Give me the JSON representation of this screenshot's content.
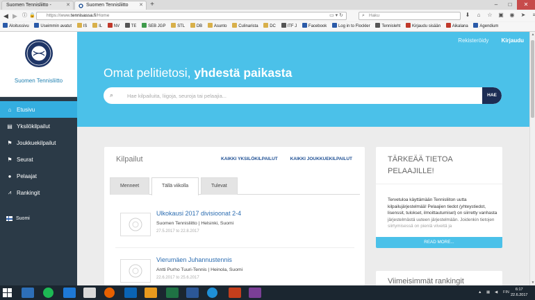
{
  "browser": {
    "tabs": [
      {
        "label": "Suomen Tennisliitto -",
        "active": false
      },
      {
        "label": "Suomen Tennisliitto",
        "active": true
      }
    ],
    "url_prefix": "https://www.",
    "url_domain": "tennisassa.fi",
    "url_path": "/Home",
    "search_placeholder": "Haku",
    "bookmarks": [
      "Aloitussivu",
      "Useimmin avatut",
      "IS",
      "IL",
      "NV",
      "TE",
      "SEB JGP",
      "STL",
      "DB",
      "Asunto",
      "Culinarista",
      "DC",
      "ITF J",
      "Facebook",
      "Log in to Flockler",
      "Tennisleht",
      "Kirjaudu sisään",
      "Aikalana",
      "Agendium"
    ]
  },
  "sidebar": {
    "brand_name": "Suomen Tennisliitto",
    "items": [
      {
        "label": "Etusivu",
        "icon": "home-icon",
        "active": true
      },
      {
        "label": "Yksilökilpailut",
        "icon": "id-card-icon",
        "active": false
      },
      {
        "label": "Joukkuekilpailut",
        "icon": "flag-icon",
        "active": false
      },
      {
        "label": "Seurat",
        "icon": "flag-icon",
        "active": false
      },
      {
        "label": "Pelaajat",
        "icon": "user-icon",
        "active": false
      },
      {
        "label": "Rankingit",
        "icon": "chart-icon",
        "active": false
      }
    ],
    "language": "Suomi"
  },
  "header": {
    "register": "Rekisteröidy",
    "login": "Kirjaudu",
    "title_light": "Omat pelitietosi, ",
    "title_bold": "yhdestä paikasta",
    "search_placeholder": "Hae kilpailuita, liigoja, seuroja tai pelaajia...",
    "search_button": "HAE"
  },
  "competitions": {
    "title": "Kilpailut",
    "link_individual": "KAIKKI YKSILÖKILPAILUT",
    "link_team": "KAIKKI JOUKKUEKILPAILUT",
    "tabs": [
      {
        "label": "Menneet",
        "active": false
      },
      {
        "label": "Tällä viikolla",
        "active": true
      },
      {
        "label": "Tulevat",
        "active": false
      }
    ],
    "items": [
      {
        "name": "Ulkokausi 2017 divisioonat 2-4",
        "organizer": "Suomen Tennisliitto | Helsinki, Suomi",
        "dates": "27.5.2017 to 22.8.2017"
      },
      {
        "name": "Vierumäen Juhannustennis",
        "organizer": "Antti Purho Tuuri-Tennis | Heinola, Suomi",
        "dates": "22.6.2017 to 25.6.2017"
      }
    ]
  },
  "info": {
    "title": "TÄRKEÄÄ TIETOA PELAAJILLE!",
    "body": "Tervetuloa käyttämään Tennisliiton uutta kilpailujärjestelmää! Pelaajien tiedot (yhteystiedot, lisenssit, tulokset, ilmoittautumiset) on siirretty vanhasta järjestelmästä uuteen järjestelmään. Joidenkin tietojen siirtymisessä on pieniä viiveitä ja",
    "read_more": "READ MORE..."
  },
  "rankings": {
    "title": "Viimeisimmät rankingit"
  },
  "taskbar": {
    "language": "FIN",
    "time": "6:17",
    "date": "22.6.2017"
  }
}
